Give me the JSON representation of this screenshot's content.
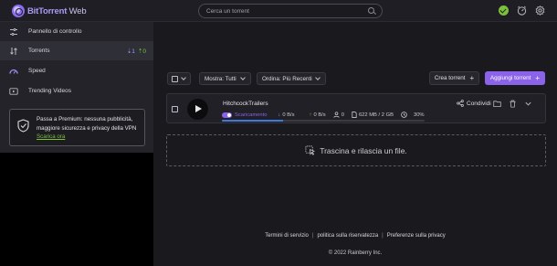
{
  "app": {
    "brand": "BitTorrent",
    "brand_suffix": " Web"
  },
  "search": {
    "placeholder": "Cerca un torrent"
  },
  "sidebar": {
    "items": [
      {
        "label": "Pannello di controllo",
        "icon": "dashboard-icon"
      },
      {
        "label": "Torrents",
        "icon": "torrents-icon",
        "count_down": "1",
        "count_up": "0",
        "down_arrow": "⇣",
        "up_arrow": "⇡"
      },
      {
        "label": "Speed",
        "icon": "speed-icon"
      },
      {
        "label": "Trending Videos",
        "icon": "video-icon"
      }
    ],
    "promo": {
      "text": "Passa a Premium: nessuna pubblicità, maggiore sicurezza e privacy della VPN ",
      "link": "Scarica ora"
    }
  },
  "toolbar": {
    "show_label": "Mostra: Tutti",
    "sort_label": "Ordina: Più Recenti",
    "create_label": "Crea torrent",
    "add_label": "Aggiungi torrent"
  },
  "torrent": {
    "name": "HitchcockTrailers",
    "status": "Scaricamento",
    "download_speed": "0 B/s",
    "upload_speed": "0 B/s",
    "peers": "0",
    "size": "622 MB / 2 GB",
    "percent": "30%",
    "progress": 0.3,
    "share_label": "Condividi"
  },
  "dropzone": {
    "text": "Trascina e rilascia un file."
  },
  "footer": {
    "terms": "Termini di servizio",
    "privacy": "politica sulla riservatezza",
    "preferences": "Preferenze sulla privacy",
    "copyright": "© 2022 Rainberry Inc."
  },
  "colors": {
    "accent": "#8a63ea",
    "green": "#7cc13b",
    "progress": "#3f78d8"
  }
}
